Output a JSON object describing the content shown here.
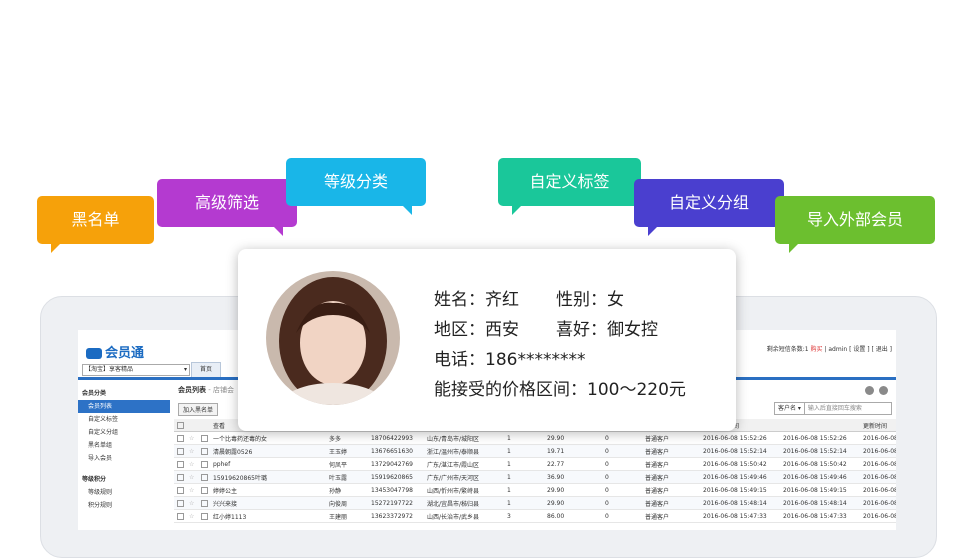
{
  "tags": [
    {
      "id": "blacklist",
      "label": "黑名单",
      "color": "#f6a10a"
    },
    {
      "id": "advanced-filter",
      "label": "高级筛选",
      "color": "#b43ad0"
    },
    {
      "id": "level-category",
      "label": "等级分类",
      "color": "#19b6e8"
    },
    {
      "id": "custom-tag",
      "label": "自定义标签",
      "color": "#1ac79a"
    },
    {
      "id": "custom-group",
      "label": "自定义分组",
      "color": "#4a3fcf"
    },
    {
      "id": "import-members",
      "label": "导入外部会员",
      "color": "#6cbf2f"
    }
  ],
  "profile": {
    "name": "姓名：齐红",
    "gender": "性别：女",
    "region": "地区：西安",
    "hobby": "喜好：御女控",
    "phone": "电话：186********",
    "price_range": "能接受的价格区间：100～220元"
  },
  "app": {
    "logo": "会员通",
    "shop": "【淘宝】享客精品",
    "top_links_prefix": "剩余短信条数:1",
    "top_links_buy": "购买",
    "top_links_suffix": "| admin [ 设置 ] [ 退出 ]",
    "tab_home": "首页",
    "sidebar": {
      "group1": "会员分类",
      "items1": [
        "会员列表",
        "自定义标签",
        "自定义分组",
        "黑名单组",
        "导入会员"
      ],
      "group2": "等级积分",
      "items2": [
        "等级规则",
        "积分规则"
      ]
    },
    "main": {
      "title": "会员列表",
      "title_sub": " - 店铺会",
      "add_blacklist": "加入黑名单",
      "search_label": "客户名 ▾",
      "search_placeholder": "输入后直接回车搜索",
      "col_view": "查看",
      "col_last_order": "最后下单时间",
      "col_update": "更新时间",
      "rows": [
        [
          "一个比毒药还毒的女",
          "多多",
          "18706422993",
          "山东/青岛市/城阳区",
          "1",
          "29.90",
          "0",
          "普通客户",
          "2016-06-08 15:52:26",
          "2016-06-08 15:52:26",
          "2016-06-08"
        ],
        [
          "清晨朝露0526",
          "王玉婷",
          "13676651630",
          "浙江/温州市/泰顺县",
          "1",
          "19.71",
          "0",
          "普通客户",
          "2016-06-08 15:52:14",
          "2016-06-08 15:52:14",
          "2016-06-08"
        ],
        [
          "pphef",
          "何凤平",
          "13729042769",
          "广东/湛江市/霞山区",
          "1",
          "22.77",
          "0",
          "普通客户",
          "2016-06-08 15:50:42",
          "2016-06-08 15:50:42",
          "2016-06-08"
        ],
        [
          "15919620865叶璐",
          "叶玉露",
          "15919620865",
          "广东/广州市/天河区",
          "1",
          "36.90",
          "0",
          "普通客户",
          "2016-06-08 15:49:46",
          "2016-06-08 15:49:46",
          "2016-06-08"
        ],
        [
          "婷婷公主",
          "孙静",
          "13453047798",
          "山西/忻州市/繁峙县",
          "1",
          "29.90",
          "0",
          "普通客户",
          "2016-06-08 15:49:15",
          "2016-06-08 15:49:15",
          "2016-06-08"
        ],
        [
          "兴兴来接",
          "向俊周",
          "15272197722",
          "湖北/宜昌市/秭归县",
          "1",
          "29.90",
          "0",
          "普通客户",
          "2016-06-08 15:48:14",
          "2016-06-08 15:48:14",
          "2016-06-08"
        ],
        [
          "红小婷1113",
          "王建丽",
          "13623372972",
          "山西/长治市/武乡县",
          "3",
          "86.00",
          "0",
          "普通客户",
          "2016-06-08 15:47:33",
          "2016-06-08 15:47:33",
          "2016-06-08"
        ]
      ]
    }
  }
}
